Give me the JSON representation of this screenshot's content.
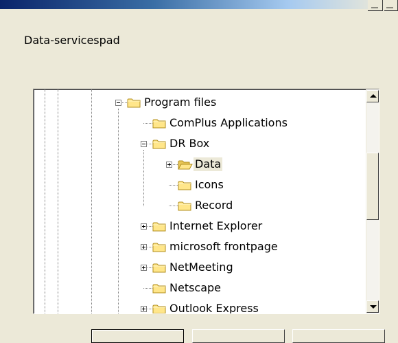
{
  "dialog": {
    "prompt": "Data-servicespad"
  },
  "tree": {
    "nodes": [
      {
        "label": "Program files",
        "expander": "minus"
      },
      {
        "label": "ComPlus Applications",
        "expander": "none"
      },
      {
        "label": "DR Box",
        "expander": "minus"
      },
      {
        "label": "Data",
        "expander": "plus",
        "selected": true,
        "open_folder": true
      },
      {
        "label": "Icons",
        "expander": "none"
      },
      {
        "label": "Record",
        "expander": "none"
      },
      {
        "label": "Internet Explorer",
        "expander": "plus"
      },
      {
        "label": "microsoft frontpage",
        "expander": "plus"
      },
      {
        "label": "NetMeeting",
        "expander": "plus"
      },
      {
        "label": "Netscape",
        "expander": "none"
      },
      {
        "label": "Outlook Express",
        "expander": "plus",
        "partially_visible": true
      }
    ]
  },
  "icons": {
    "folder": "folder-icon",
    "folder_open": "folder-open-icon",
    "scroll_up": "scroll-up-arrow-icon",
    "scroll_down": "scroll-down-arrow-icon"
  },
  "colors": {
    "titlebar_start": "#0a246a",
    "dialog_bg": "#ece9d8",
    "folder_fill": "#ffe68a",
    "folder_stroke": "#b08d1d"
  }
}
